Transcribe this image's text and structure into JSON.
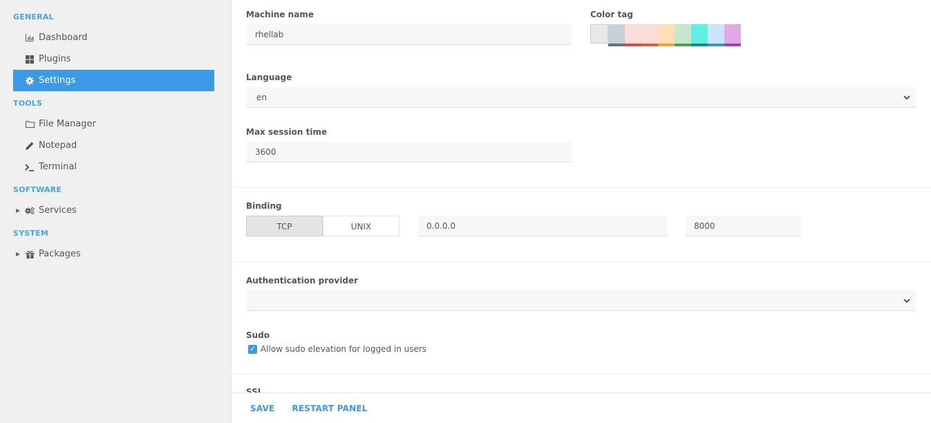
{
  "sidebar": {
    "sections": [
      {
        "title": "GENERAL",
        "items": [
          {
            "label": "Dashboard",
            "icon": "dashboard-chart-icon"
          },
          {
            "label": "Plugins",
            "icon": "grid-icon"
          },
          {
            "label": "Settings",
            "icon": "gear-icon",
            "active": true
          }
        ]
      },
      {
        "title": "TOOLS",
        "items": [
          {
            "label": "File Manager",
            "icon": "folder-icon"
          },
          {
            "label": "Notepad",
            "icon": "pencil-icon"
          },
          {
            "label": "Terminal",
            "icon": "terminal-icon"
          }
        ]
      },
      {
        "title": "SOFTWARE",
        "items": [
          {
            "label": "Services",
            "icon": "gears-icon",
            "expandable": true
          }
        ]
      },
      {
        "title": "SYSTEM",
        "items": [
          {
            "label": "Packages",
            "icon": "gift-icon",
            "expandable": true
          }
        ]
      }
    ]
  },
  "settings": {
    "machine_name_label": "Machine name",
    "machine_name_value": "rhellab",
    "color_tag_label": "Color tag",
    "color_tags": [
      {
        "fill": "#e8e8e8",
        "bar": "#e8e8e8",
        "selected": true
      },
      {
        "fill": "#c9d0d6",
        "bar": "#607080"
      },
      {
        "fill": "#fcdcdc",
        "bar": "#d24a4a"
      },
      {
        "fill": "#fcdcd8",
        "bar": "#db5a45"
      },
      {
        "fill": "#fde0b6",
        "bar": "#e8a040"
      },
      {
        "fill": "#c8e6ca",
        "bar": "#4c9c5a"
      },
      {
        "fill": "#5ff0e2",
        "bar": "#1c8c80"
      },
      {
        "fill": "#cce4fa",
        "bar": "#4090d0"
      },
      {
        "fill": "#e2a8e8",
        "bar": "#a040b0"
      }
    ],
    "language_label": "Language",
    "language_value": "en",
    "max_session_label": "Max session time",
    "max_session_value": "3600",
    "binding_label": "Binding",
    "binding_options": [
      "TCP",
      "UNIX"
    ],
    "binding_selected": "TCP",
    "binding_host": "0.0.0.0",
    "binding_port": "8000",
    "auth_label": "Authentication provider",
    "auth_value": "",
    "sudo_label": "Sudo",
    "sudo_checkbox_label": "Allow sudo elevation for logged in users",
    "sudo_checked": true,
    "ssl_label": "SSL"
  },
  "footer": {
    "save_label": "SAVE",
    "restart_label": "RESTART PANEL"
  },
  "colors": {
    "accent": "#3b99e6",
    "section_title": "#4aa3df"
  }
}
